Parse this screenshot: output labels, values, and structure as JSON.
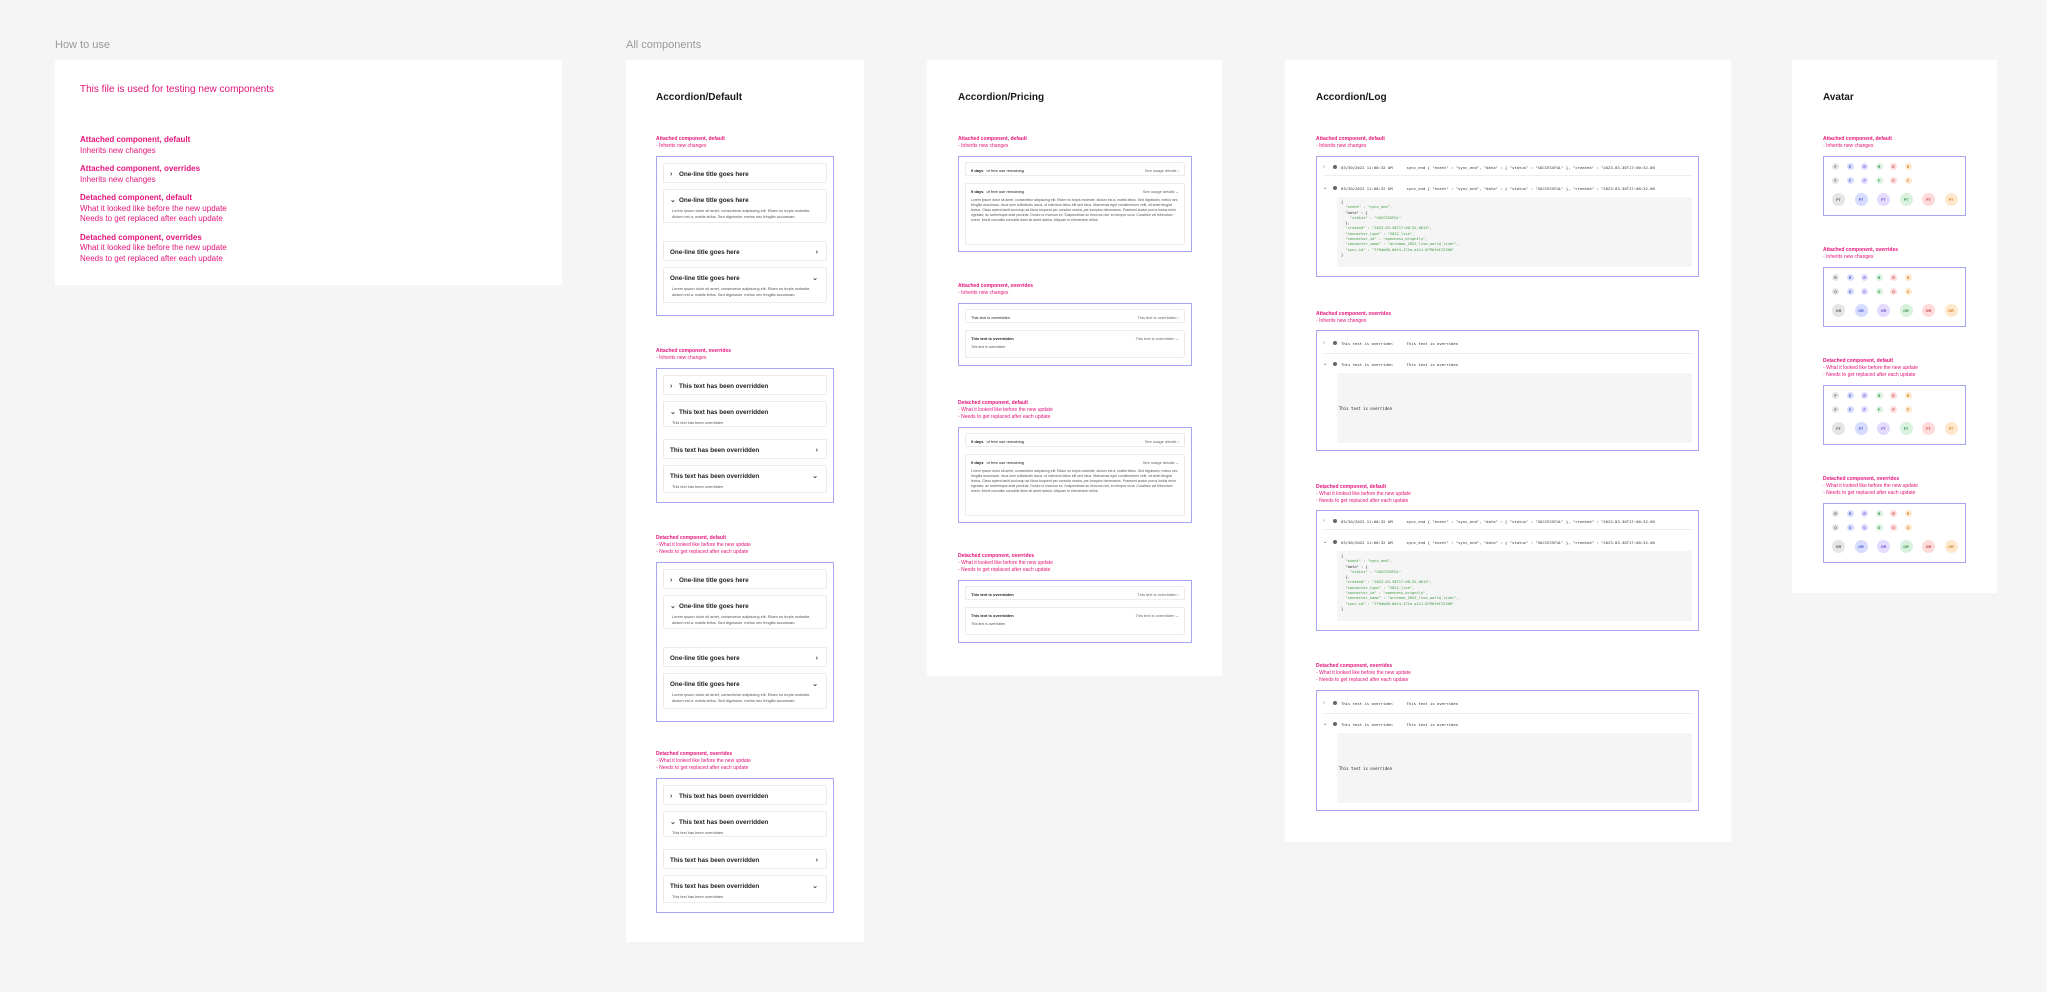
{
  "sections": {
    "how_to_use": "How to use",
    "all_components": "All components"
  },
  "how_to": {
    "headline": "This file is used for testing new components",
    "items": [
      {
        "title": "Attached component, default",
        "lines": [
          "Inherits new changes"
        ]
      },
      {
        "title": "Attached component, overrides",
        "lines": [
          "Inherits new changes"
        ]
      },
      {
        "title": "Detached component, default",
        "lines": [
          "What it looked like before the new update",
          "Needs to get replaced after each update"
        ]
      },
      {
        "title": "Detached component, overrides",
        "lines": [
          "What it looked like before the new update",
          "Needs to get replaced after each update"
        ]
      }
    ]
  },
  "notes": {
    "att_def": "Attached component, default",
    "att_ovr": "Attached component, overrides",
    "det_def": "Detached component, default",
    "det_ovr": "Detached component, overrides",
    "inherits": "◦ Inherits new changes",
    "before": "◦ What it looked like before the new update",
    "replace": "◦ Needs to get replaced after each update"
  },
  "accordion_default": {
    "title": "Accordion/Default",
    "default_items": [
      "One-line title goes here",
      "One-line title goes here",
      "One-line title goes here",
      "One-line title goes here"
    ],
    "override_items": [
      "This text has been overridden",
      "This text has been overridden",
      "This text has been overridden",
      "This text has been overridden"
    ],
    "lorem": "Lorem ipsum dolor sit amet, consectetur adipiscing elit. Etiam eu turpis molestie, dictum est a, mattis tellus. Sed dignissim, metus nec fringilla accumsan.",
    "override_body": "This text has been overridden"
  },
  "accordion_pricing": {
    "title": "Accordion/Pricing",
    "days_bold": "9 days",
    "days_rest": "of free use remaining",
    "link": "See usage details",
    "lorem": "Lorem ipsum dolor sit amet, consectetur adipiscing elit. Etiam eu turpis molestie, dictum est a, mattis tellus. Sed dignissim, metus nec fringilla accumsan, risus sem sollicitudin lacus, ut interdum tellus elit sed risus. Maecenas eget condimentum velit, sit amet feugiat lectus. Class aptent taciti sociosqu ad litora torquent per conubia nostra, per inceptos himenaeos. Praesent auctor purus luctus enim egestas, ac scelerisque ante pulvinar. Donec ut rhoncus ex. Suspendisse ac rhoncus nisl, eu tempor urna. Curabitur vel bibendum lorem. Morbi convallis convallis diam sit amet lacinia. Aliquam in elementum tellus.",
    "ovr_left": "This text is overridden",
    "ovr_left_bold": "This text is overridden",
    "ovr_right": "This text is overridden",
    "ovr_body": "This text is overridden"
  },
  "accordion_log": {
    "title": "Accordion/Log",
    "timestamp": "03/30/2022 11:00:32 AM",
    "message": "sync_end { \"event\" : \"sync_end\", \"data\" : { \"status\" : \"SUCCESSFUL\" }, \"created\" : \"2023-03-30T17:00:32.00",
    "json_lines": [
      "{",
      "  \"event\" : \"sync_end\",",
      "  \"data\" : {",
      "    \"status\" : \"SUCCESSFUL\"",
      "  },",
      "  \"created\" : \"2023-03-30T17:00:32.061Z\",",
      "  \"connector_type\" : \"2022_live\",",
      "  \"connector_id\" : \"openness_brightly\",",
      "  \"connector_name\" : \"archaeo_2022_live_world_liver\",",
      "  \"sync_id\" : \"7f9ab00-b0f4-471e-a2c1-8796fdf22306\"",
      "}"
    ],
    "ovr_a": "This text is overriden",
    "ovr_b": "This text is overriden",
    "ovr_body": "This text is overriden"
  },
  "avatar": {
    "title": "Avatar",
    "small": [
      "F",
      "E",
      "R",
      "R",
      "E",
      "R"
    ],
    "medium": [
      "F",
      "F",
      "F",
      "F",
      "F",
      "F"
    ],
    "large": [
      "FT",
      "FT",
      "FT",
      "FT",
      "FT",
      "FT"
    ],
    "ovr_small": [
      "R",
      "R",
      "R",
      "R",
      "R",
      "R"
    ],
    "ovr_medium": [
      "O",
      "O",
      "O",
      "O",
      "O",
      "O"
    ],
    "ovr_large": [
      "OR",
      "OR",
      "OR",
      "OR",
      "OR",
      "OR"
    ]
  },
  "colors": {
    "accent": "#e4147a",
    "frame": "#a7a6f2",
    "background": "#f5f5f5"
  }
}
